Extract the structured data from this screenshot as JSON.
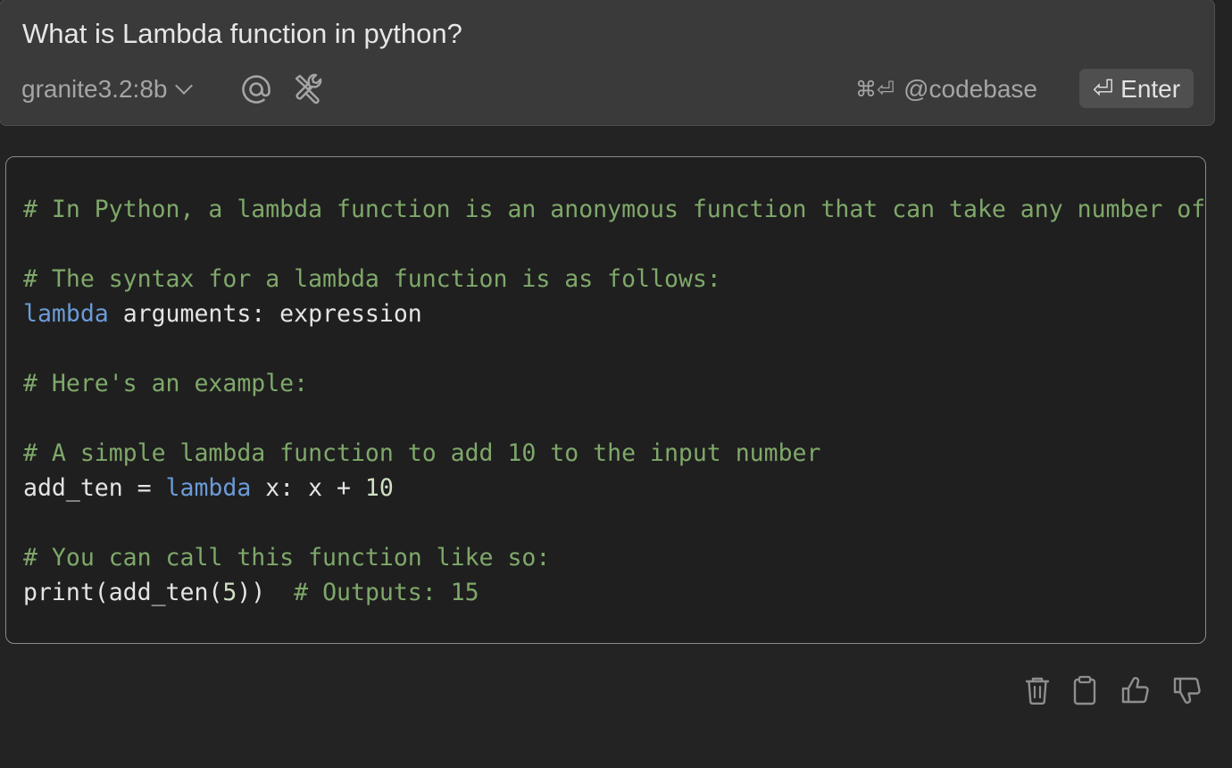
{
  "input": {
    "prompt": "What is Lambda function in python?",
    "model": "granite3.2:8b",
    "codebase_shortcut": "⌘⏎",
    "codebase_label": "@codebase",
    "enter_label": "⏎ Enter"
  },
  "code": {
    "lines": [
      [
        {
          "t": "# In Python, a lambda function is an anonymous function that can take any number of arguments, but can only have one expression.",
          "c": "comment"
        }
      ],
      [],
      [
        {
          "t": "# The syntax for a lambda function is as follows:",
          "c": "comment"
        }
      ],
      [
        {
          "t": "lambda",
          "c": "keyword"
        },
        {
          "t": " arguments: expression",
          "c": "plain"
        }
      ],
      [],
      [
        {
          "t": "# Here's an example:",
          "c": "comment"
        }
      ],
      [],
      [
        {
          "t": "# A simple lambda function to add 10 to the input number",
          "c": "comment"
        }
      ],
      [
        {
          "t": "add_ten = ",
          "c": "plain"
        },
        {
          "t": "lambda",
          "c": "keyword"
        },
        {
          "t": " x: x + ",
          "c": "plain"
        },
        {
          "t": "10",
          "c": "number"
        }
      ],
      [],
      [
        {
          "t": "# You can call this function like so:",
          "c": "comment"
        }
      ],
      [
        {
          "t": "print(add_ten(",
          "c": "plain"
        },
        {
          "t": "5",
          "c": "number"
        },
        {
          "t": "))  ",
          "c": "plain"
        },
        {
          "t": "# Outputs: 15",
          "c": "comment"
        }
      ]
    ]
  },
  "actions": [
    {
      "name": "delete-icon"
    },
    {
      "name": "copy-icon"
    },
    {
      "name": "thumbs-up-icon"
    },
    {
      "name": "thumbs-down-icon"
    }
  ],
  "colors": {
    "background": "#232323",
    "input_bg": "#3a3a3a",
    "code_bg": "#1f1f1f",
    "comment": "#7fa86a",
    "keyword": "#6b9bd8"
  }
}
